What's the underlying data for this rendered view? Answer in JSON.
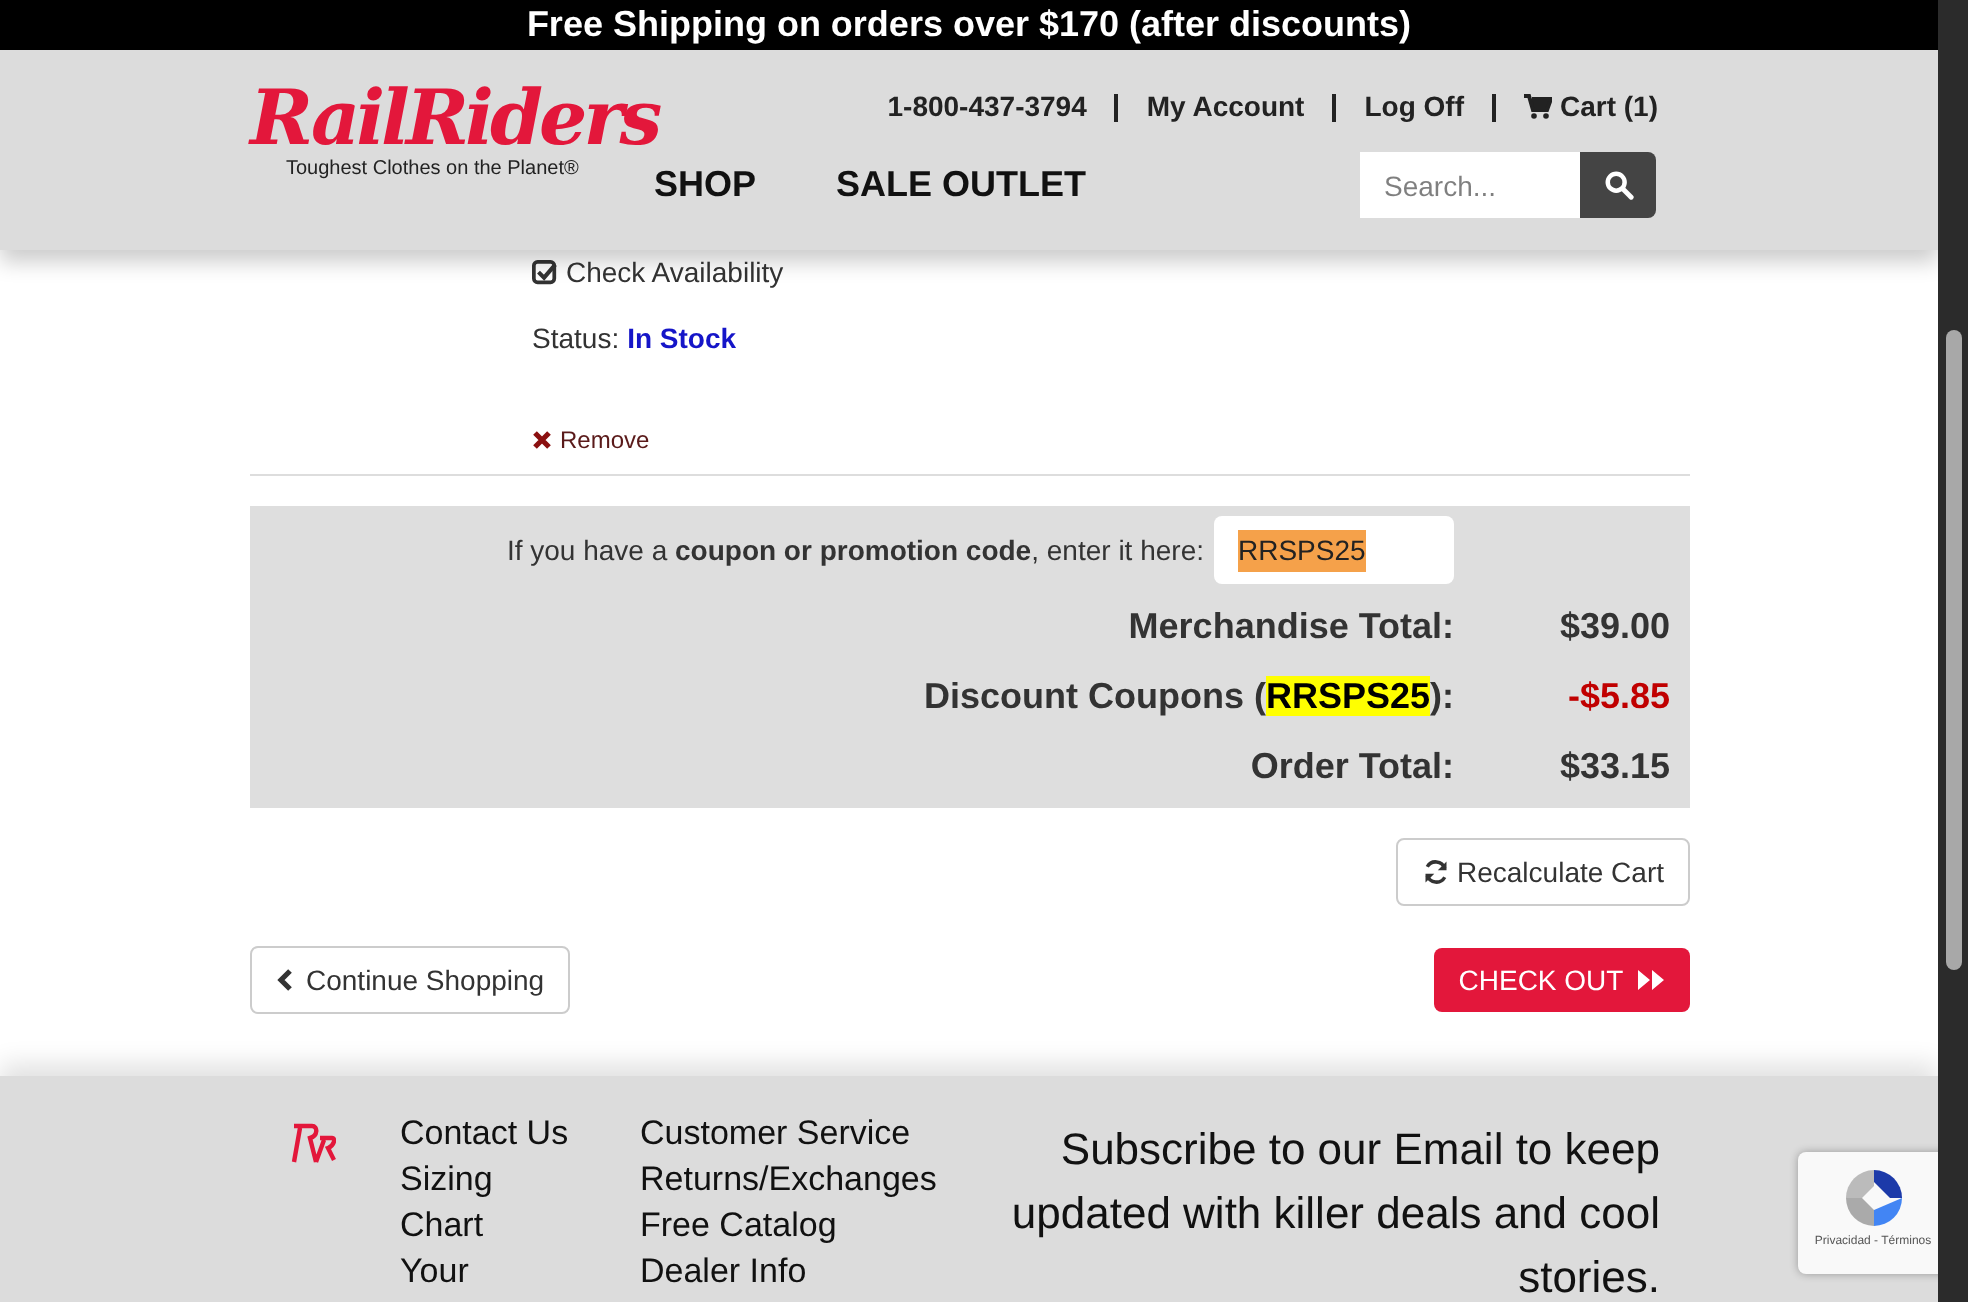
{
  "promo_bar": {
    "text": "Free Shipping on orders over $170 (after discounts)"
  },
  "header": {
    "logo": {
      "name": "RailRiders",
      "tagline": "Toughest Clothes on the Planet®"
    },
    "top_links": [
      "1-800-437-3794",
      "My Account",
      "Log Off",
      "Cart (1)"
    ],
    "nav": [
      "SHOP",
      "SALE OUTLET"
    ],
    "search": {
      "placeholder": "Search..."
    }
  },
  "cart_item": {
    "check_availability": "Check Availability",
    "status_label": "Status:",
    "status_value": "In Stock",
    "remove": "Remove"
  },
  "summary": {
    "coupon_prompt": "If you have a **coupon or promotion code**, enter it here:",
    "coupon_value": "RRSPS25",
    "rows": [
      {
        "kind": "plain",
        "label": "Merchandise Total:",
        "value": "$39.00"
      },
      {
        "kind": "discount",
        "label": "Discount Coupons (",
        "code": "RRSPS25",
        "label_end": "):",
        "value": "-$5.85"
      },
      {
        "kind": "plain",
        "label": "Order Total:",
        "value": "$33.15"
      }
    ]
  },
  "buttons": {
    "recalculate": "Recalculate Cart",
    "continue": "Continue Shopping",
    "checkout": "CHECK OUT"
  },
  "footer": {
    "columns": [
      [
        "Contact Us",
        "Sizing",
        "Chart",
        "Your"
      ],
      [
        "Customer Service",
        "Returns/Exchanges",
        "Free Catalog",
        "Dealer Info"
      ]
    ],
    "subscribe": "Subscribe to our Email to keep updated with killer deals and cool stories.",
    "recaptcha": "Privacidad - Términos"
  }
}
